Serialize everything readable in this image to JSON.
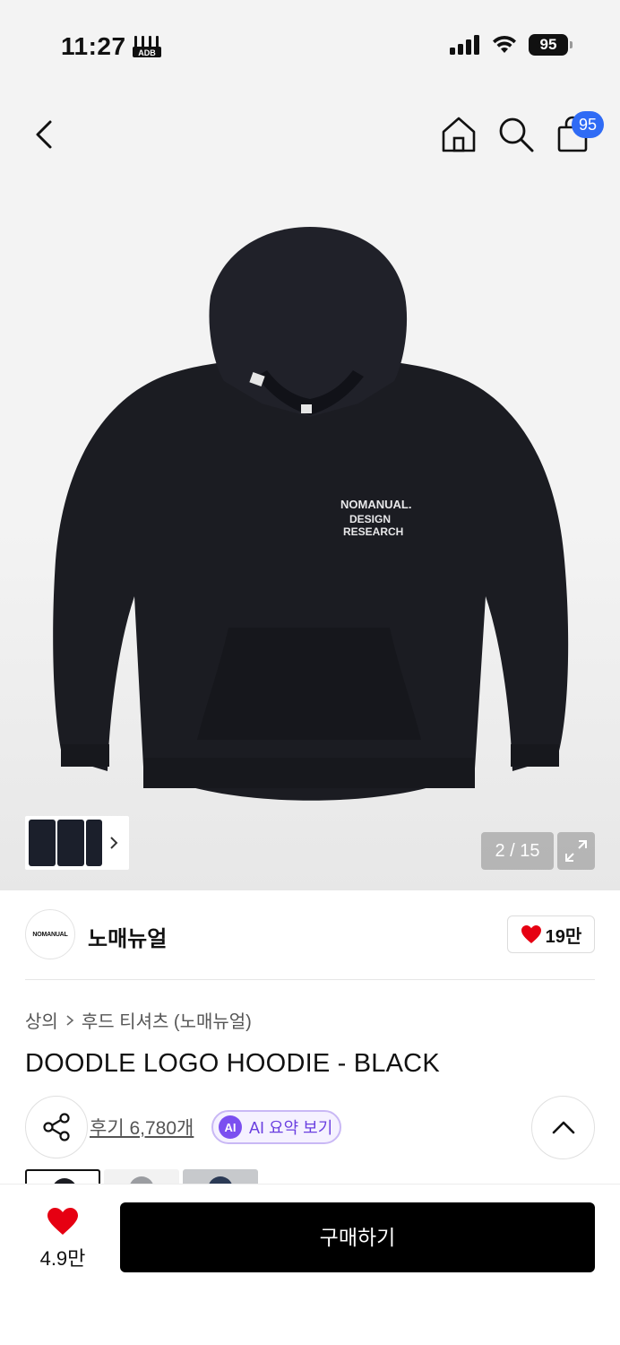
{
  "status_bar": {
    "time": "11:27",
    "battery": "95",
    "icons": [
      "adb-icon",
      "signal-icon",
      "wifi-icon",
      "battery-icon"
    ]
  },
  "nav": {
    "icons": [
      "back-arrow-icon",
      "home-icon",
      "search-icon",
      "cart-icon"
    ],
    "cart_count": "95"
  },
  "gallery": {
    "counter": "2 / 15",
    "print_lines": [
      "NOMANUAL.",
      "DESIGN",
      "RESEARCH"
    ],
    "product_color": "#1b1c22",
    "background": "#f3f3f3"
  },
  "brand": {
    "logo_text": "NOMANUAL",
    "name": "노매뉴얼",
    "likes": "19만"
  },
  "breadcrumb": {
    "level1": "상의",
    "level2": "후드 티셔츠 (노매뉴얼)"
  },
  "product": {
    "title": "DOODLE LOGO HOODIE - BLACK",
    "reviews": "후기 6,780개",
    "ai_badge": "AI",
    "ai_label": "AI 요약 보기"
  },
  "bottom": {
    "wish_count": "4.9만",
    "buy_label": "구매하기",
    "accent": "#e60012"
  }
}
